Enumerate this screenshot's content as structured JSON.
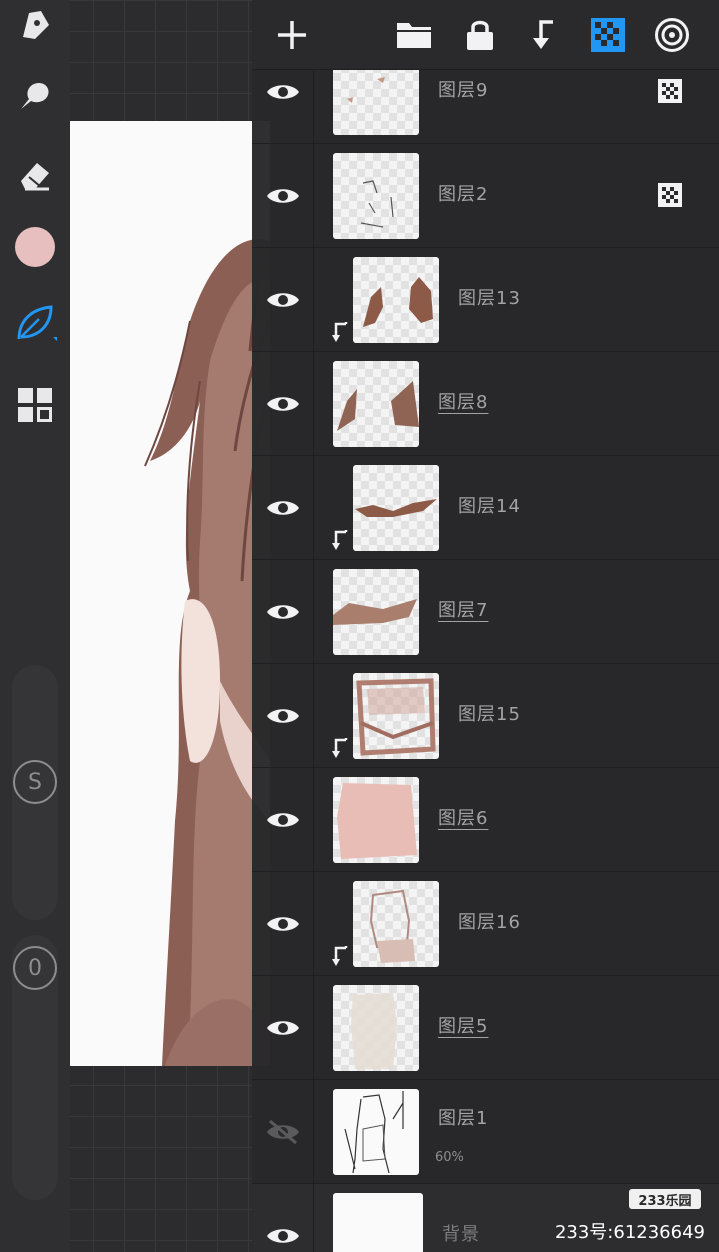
{
  "app": {
    "accent": "#2196f3",
    "brush_color": "#e6bfbe"
  },
  "toolbar": {
    "tools": [
      "pen-icon",
      "smudge-icon",
      "eraser-icon",
      "color-swatch",
      "brush-leaf-icon",
      "layers-grid-icon"
    ],
    "size_label": "S",
    "opacity_label": "0"
  },
  "header": {
    "buttons": [
      "add-layer",
      "folder",
      "lock",
      "clip-down",
      "alpha-lock",
      "layer-properties"
    ]
  },
  "layers": [
    {
      "name": "图层9",
      "visible": true,
      "clipped": false,
      "alpha_locked": true,
      "underline": false
    },
    {
      "name": "图层2",
      "visible": true,
      "clipped": false,
      "alpha_locked": true,
      "underline": false
    },
    {
      "name": "图层13",
      "visible": true,
      "clipped": true,
      "alpha_locked": false,
      "underline": false
    },
    {
      "name": "图层8",
      "visible": true,
      "clipped": false,
      "alpha_locked": false,
      "underline": true
    },
    {
      "name": "图层14",
      "visible": true,
      "clipped": true,
      "alpha_locked": false,
      "underline": false
    },
    {
      "name": "图层7",
      "visible": true,
      "clipped": false,
      "alpha_locked": false,
      "underline": true
    },
    {
      "name": "图层15",
      "visible": true,
      "clipped": true,
      "alpha_locked": false,
      "underline": false
    },
    {
      "name": "图层6",
      "visible": true,
      "clipped": false,
      "alpha_locked": false,
      "underline": true
    },
    {
      "name": "图层16",
      "visible": true,
      "clipped": true,
      "alpha_locked": false,
      "underline": false
    },
    {
      "name": "图层5",
      "visible": true,
      "clipped": false,
      "alpha_locked": false,
      "underline": true
    },
    {
      "name": "图层1",
      "visible": false,
      "clipped": false,
      "alpha_locked": false,
      "underline": false,
      "opacity": "60%"
    },
    {
      "name": "背景",
      "visible": true,
      "clipped": false,
      "alpha_locked": false,
      "underline": false
    }
  ],
  "watermark": {
    "logo": "233乐园",
    "text": "233号:61236649"
  }
}
